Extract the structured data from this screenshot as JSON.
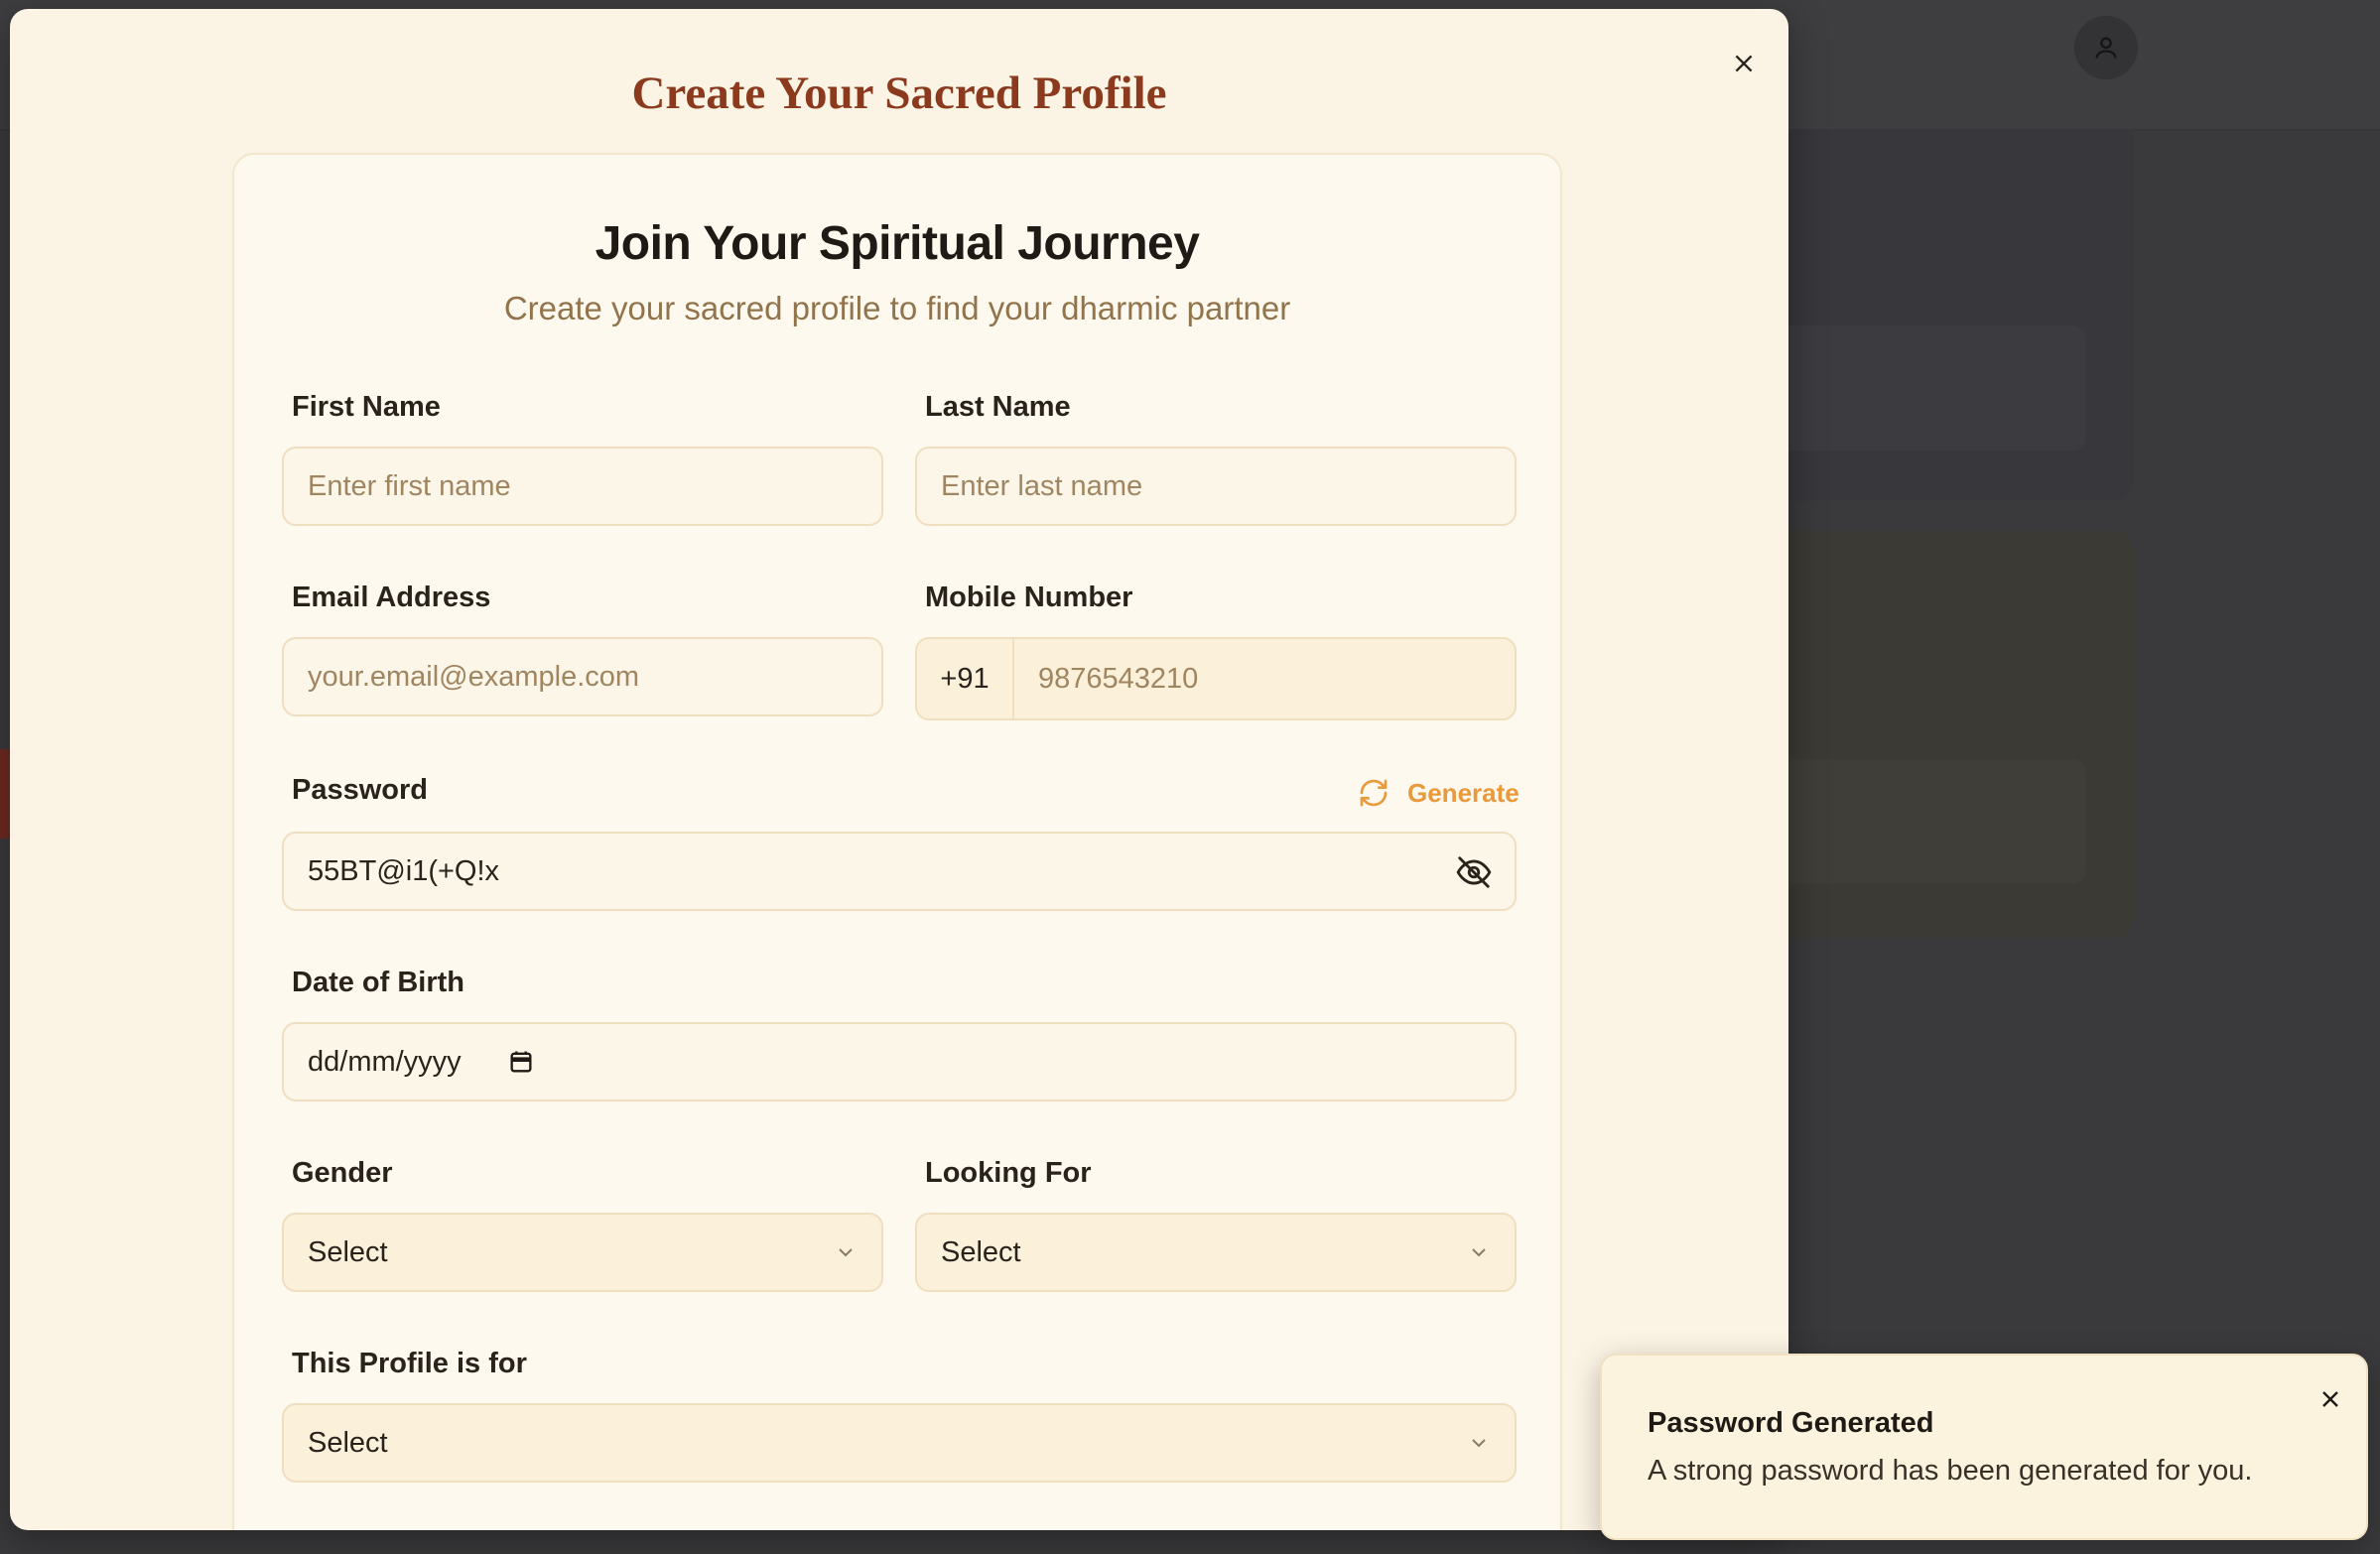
{
  "modal": {
    "title": "Create Your Sacred Profile",
    "close_icon": "close-icon"
  },
  "form": {
    "heading": "Join Your Spiritual Journey",
    "subheading": "Create your sacred profile to find your dharmic partner",
    "first_name": {
      "label": "First Name",
      "placeholder": "Enter first name",
      "value": ""
    },
    "last_name": {
      "label": "Last Name",
      "placeholder": "Enter last name",
      "value": ""
    },
    "email": {
      "label": "Email Address",
      "placeholder": "your.email@example.com",
      "value": ""
    },
    "mobile": {
      "label": "Mobile Number",
      "country_code": "+91",
      "placeholder": "9876543210"
    },
    "password": {
      "label": "Password",
      "value": "55BT@i1(+Q!x",
      "generate_label": "Generate",
      "generate_icon": "refresh-icon",
      "visibility_icon": "eye-off-icon"
    },
    "dob": {
      "label": "Date of Birth",
      "placeholder": "dd/mm/yyyy",
      "icon": "calendar-icon"
    },
    "gender": {
      "label": "Gender",
      "selected": "Select"
    },
    "looking_for": {
      "label": "Looking For",
      "selected": "Select"
    },
    "profile_for": {
      "label": "This Profile is for",
      "selected": "Select"
    }
  },
  "toast": {
    "title": "Password Generated",
    "message": "A strong password has been generated for you."
  },
  "colors": {
    "accent": "#e89a3c",
    "title": "#8b3a1e",
    "modal_bg": "#fbf3e3"
  }
}
